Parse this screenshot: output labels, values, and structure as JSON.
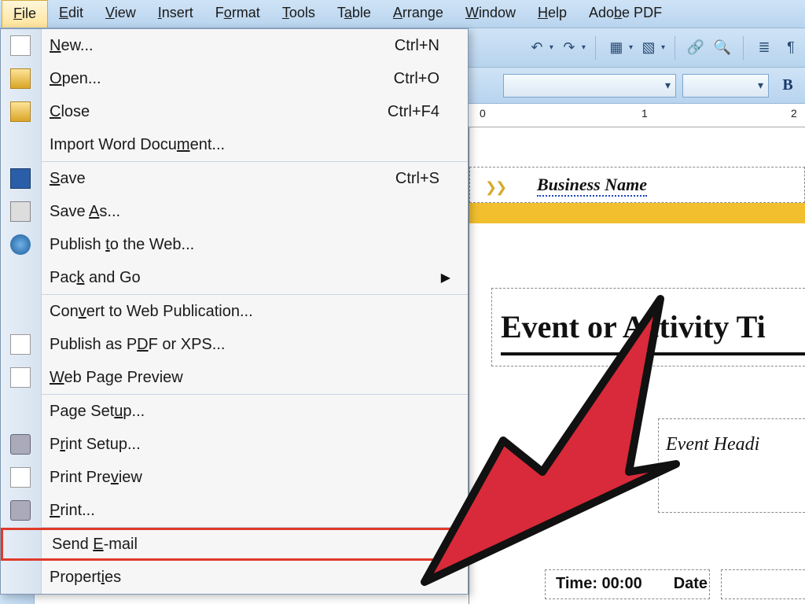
{
  "menubar": {
    "items": [
      {
        "label": "File",
        "mnemonic": "F",
        "active": true
      },
      {
        "label": "Edit",
        "mnemonic": "E"
      },
      {
        "label": "View",
        "mnemonic": "V"
      },
      {
        "label": "Insert",
        "mnemonic": "I"
      },
      {
        "label": "Format",
        "mnemonic": "o"
      },
      {
        "label": "Tools",
        "mnemonic": "T"
      },
      {
        "label": "Table",
        "mnemonic": "a"
      },
      {
        "label": "Arrange",
        "mnemonic": "A"
      },
      {
        "label": "Window",
        "mnemonic": "W"
      },
      {
        "label": "Help",
        "mnemonic": "H"
      },
      {
        "label": "Adobe PDF",
        "mnemonic": "b"
      }
    ]
  },
  "file_menu": {
    "items": [
      {
        "label": "New...",
        "mnemonic": "N",
        "shortcut": "Ctrl+N",
        "icon": "new-icon"
      },
      {
        "label": "Open...",
        "mnemonic": "O",
        "shortcut": "Ctrl+O",
        "icon": "open-icon"
      },
      {
        "label": "Close",
        "mnemonic": "C",
        "shortcut": "Ctrl+F4",
        "icon": "close-folder-icon"
      },
      {
        "label": "Import Word Document...",
        "mnemonic": "m",
        "sep_after": true
      },
      {
        "label": "Save",
        "mnemonic": "S",
        "shortcut": "Ctrl+S",
        "icon": "save-icon"
      },
      {
        "label": "Save As...",
        "mnemonic": "A",
        "icon": "save-as-icon"
      },
      {
        "label": "Publish to the Web...",
        "mnemonic": "t",
        "icon": "web-icon"
      },
      {
        "label": "Pack and Go",
        "mnemonic": "k",
        "submenu": true,
        "sep_after": true
      },
      {
        "label": "Convert to Web Publication...",
        "mnemonic": "v"
      },
      {
        "label": "Publish as PDF or XPS...",
        "mnemonic": "d",
        "icon": "pdf-icon"
      },
      {
        "label": "Web Page Preview",
        "mnemonic": "W",
        "icon": "web-preview-icon",
        "sep_after": true
      },
      {
        "label": "Page Setup...",
        "mnemonic": "u"
      },
      {
        "label": "Print Setup...",
        "mnemonic": "r",
        "icon": "printer-icon"
      },
      {
        "label": "Print Preview",
        "mnemonic": "v",
        "icon": "print-preview-icon"
      },
      {
        "label": "Print...",
        "mnemonic": "P",
        "icon": "printer-icon",
        "sep_after": true
      },
      {
        "label": "Send E-mail",
        "mnemonic": "E",
        "highlighted": true
      },
      {
        "label": "Properties",
        "mnemonic": "i"
      }
    ]
  },
  "toolbar2": {
    "bold_label": "B"
  },
  "ruler": {
    "marks": [
      {
        "pos": 0,
        "label": "0"
      },
      {
        "pos": 1,
        "label": "1"
      },
      {
        "pos": 2,
        "label": "2"
      }
    ]
  },
  "document": {
    "business_name": "Business Name",
    "event_title": "Event or Activity Ti",
    "event_heading": "Event Headi",
    "time_label": "Time: 00:00",
    "date_label": "Date"
  }
}
